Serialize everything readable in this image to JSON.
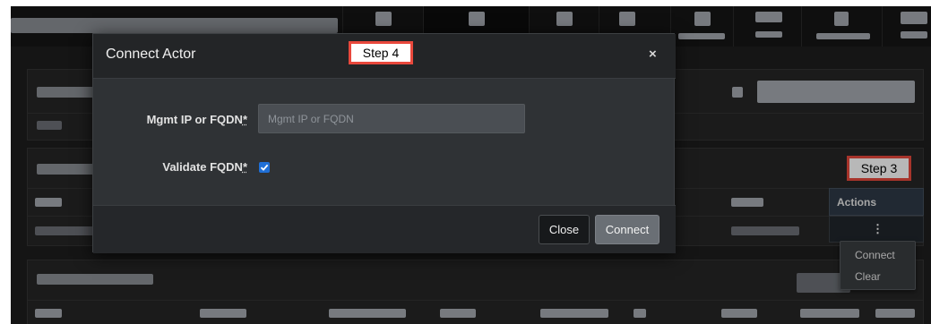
{
  "modal": {
    "title": "Connect Actor",
    "close_glyph": "×",
    "fields": {
      "mgmt_ip_label": "Mgmt IP or FQDN",
      "mgmt_ip_req": "*",
      "mgmt_ip_placeholder": "Mgmt IP or FQDN",
      "mgmt_ip_value": "",
      "validate_label": "Validate FQDN",
      "validate_req": "*",
      "validate_checked": true
    },
    "buttons": {
      "close": "Close",
      "connect": "Connect"
    }
  },
  "table": {
    "actions_header": "Actions",
    "row_menu_glyph": "⋮"
  },
  "context_menu": {
    "items": [
      "Connect",
      "Clear"
    ]
  },
  "annotations": {
    "step4": "Step 4",
    "step3": "Step 3"
  },
  "colors": {
    "accent_checkbox": "#1f6fd6",
    "annotation_border": "#e8483c",
    "actions_header_bg": "#2e3a47"
  }
}
